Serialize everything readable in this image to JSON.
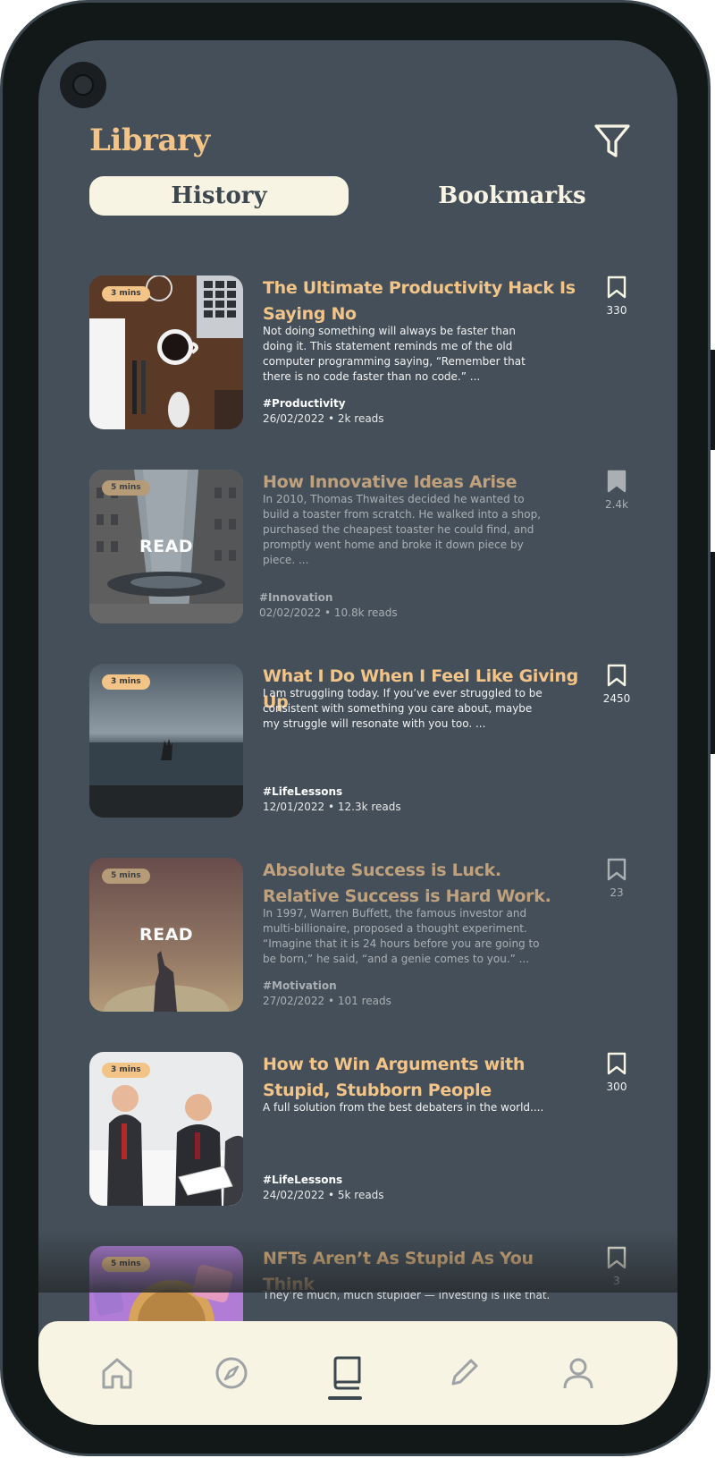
{
  "header": {
    "title": "Library"
  },
  "tabs": [
    {
      "label": "History",
      "active": true
    },
    {
      "label": "Bookmarks",
      "active": false
    }
  ],
  "articles": [
    {
      "duration": "3 mins",
      "title": "The Ultimate Productivity Hack Is Saying No",
      "excerpt": "Not doing something will always be faster than doing it. This statement reminds me of the old computer programming saying, “Remember that there is no code faster than no code.” ...",
      "tag": "#Productivity",
      "meta": "26/02/2022 • 2k reads",
      "bookmarks": "330",
      "bookmarked": false,
      "read": false,
      "overlay": ""
    },
    {
      "duration": "5 mins",
      "title": "How Innovative Ideas Arise",
      "excerpt": "In 2010, Thomas Thwaites decided he wanted to build a toaster from scratch. He walked into a shop, purchased the cheapest toaster he could find, and promptly went home and broke it down piece by piece. ...",
      "tag": "#Innovation",
      "meta": "02/02/2022 • 10.8k reads",
      "bookmarks": "2.4k",
      "bookmarked": true,
      "read": true,
      "overlay": "READ"
    },
    {
      "duration": "3 mins",
      "title": "What I Do When I Feel Like Giving Up",
      "excerpt": "I am struggling today. If you’ve ever struggled to be consistent with something you care about, maybe my struggle will resonate with you too. ...",
      "tag": "#LifeLessons",
      "meta": "12/01/2022 • 12.3k reads",
      "bookmarks": "2450",
      "bookmarked": false,
      "read": false,
      "overlay": ""
    },
    {
      "duration": "5 mins",
      "title": "Absolute Success is Luck. Relative Success is Hard Work.",
      "excerpt": "In 1997, Warren Buffett, the famous investor and multi-billionaire, proposed a thought experiment.  “Imagine that it is 24 hours before you are going to be born,” he said, “and a genie comes to you.” ...",
      "tag": "#Motivation",
      "meta": "27/02/2022 • 101 reads",
      "bookmarks": "23",
      "bookmarked": false,
      "read": true,
      "overlay": "READ"
    },
    {
      "duration": "3 mins",
      "title": "How to Win Arguments with Stupid, Stubborn People",
      "excerpt": "A full solution from the best debaters in the world....",
      "tag": "#LifeLessons",
      "meta": "24/02/2022 • 5k reads",
      "bookmarks": "300",
      "bookmarked": false,
      "read": false,
      "overlay": ""
    },
    {
      "duration": "5 mins",
      "title": "NFTs Aren’t As Stupid As You Think",
      "excerpt": "They’re much, much stupider — investing is like that.",
      "tag": "",
      "meta": "",
      "bookmarks": "3",
      "bookmarked": false,
      "read": false,
      "overlay": ""
    }
  ],
  "nav": [
    {
      "icon": "home-icon",
      "active": false
    },
    {
      "icon": "compass-icon",
      "active": false
    },
    {
      "icon": "book-icon",
      "active": true
    },
    {
      "icon": "pencil-icon",
      "active": false
    },
    {
      "icon": "user-icon",
      "active": false
    }
  ],
  "colors": {
    "screen_bg": "#444f59",
    "accent": "#f2c487",
    "cream": "#f7f4e3",
    "text_dark": "#3d4750"
  }
}
